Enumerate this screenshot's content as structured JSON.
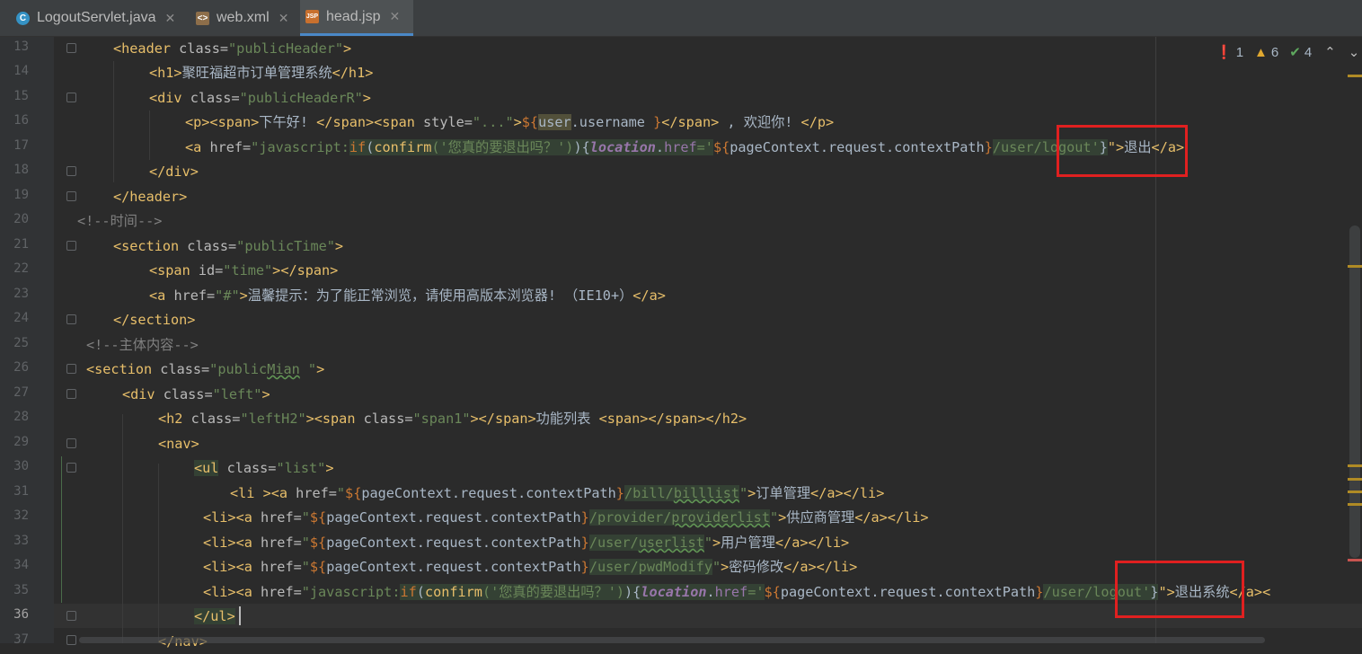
{
  "tabs": [
    {
      "label": "LogoutServlet.java",
      "icon": "java-class-icon",
      "active": false
    },
    {
      "label": "web.xml",
      "icon": "xml-file-icon",
      "active": false
    },
    {
      "label": "head.jsp",
      "icon": "jsp-file-icon",
      "active": true
    }
  ],
  "inspections": {
    "errors": "1",
    "warnings": "6",
    "weak_warnings": "4"
  },
  "current_line": "36",
  "lines": [
    {
      "n": "13"
    },
    {
      "n": "14"
    },
    {
      "n": "15"
    },
    {
      "n": "16"
    },
    {
      "n": "17"
    },
    {
      "n": "18"
    },
    {
      "n": "19"
    },
    {
      "n": "20"
    },
    {
      "n": "21"
    },
    {
      "n": "22"
    },
    {
      "n": "23"
    },
    {
      "n": "24"
    },
    {
      "n": "25"
    },
    {
      "n": "26"
    },
    {
      "n": "27"
    },
    {
      "n": "28"
    },
    {
      "n": "29"
    },
    {
      "n": "30"
    },
    {
      "n": "31"
    },
    {
      "n": "32"
    },
    {
      "n": "33"
    },
    {
      "n": "34"
    },
    {
      "n": "35"
    },
    {
      "n": "36"
    },
    {
      "n": "37"
    }
  ],
  "code": {
    "l13_tag": "<header",
    "l13_attr": " class=",
    "l13_val": "\"publicHeader\"",
    "l13_close": ">",
    "l14_open": "<h1>",
    "l14_text": "聚旺福超市订单管理系统",
    "l14_close": "</h1>",
    "l15_tag": "<div",
    "l15_attr": " class=",
    "l15_val": "\"publicHeaderR\"",
    "l15_close": ">",
    "l16_p": "<p><span>",
    "l16_text1": "下午好! ",
    "l16_mid": "</span><span",
    "l16_attr": " style=",
    "l16_val": "\"...\"",
    "l16_gt": ">",
    "l16_el1": "${",
    "l16_user": "user",
    "l16_el2": ".username ",
    "l16_el3": "}",
    "l16_end": "</span>",
    "l16_text2": " , 欢迎你! ",
    "l16_pclose": "</p>",
    "l17_tag": "<a",
    "l17_attr": " href=",
    "l17_q1": "\"javascript:",
    "l17_if": "if",
    "l17_paren": "(",
    "l17_confirm": "confirm",
    "l17_str": "('您真的要退出吗？')",
    "l17_brace": "){",
    "l17_loc": "location",
    "l17_dot": ".",
    "l17_href": "href",
    "l17_eq": "='",
    "l17_el": "${",
    "l17_ctx": "pageContext.request.contextPath",
    "l17_elc": "}",
    "l17_path": "/user/logout'",
    "l17_rb": "}",
    "l17_q2": "\">",
    "l17_text": "退出",
    "l17_close": "</a>",
    "l18": "</div>",
    "l19": "</header>",
    "l20": "<!--时间-->",
    "l21_tag": "<section",
    "l21_attr": " class=",
    "l21_val": "\"publicTime\"",
    "l21_close": ">",
    "l22_tag": "<span",
    "l22_attr": " id=",
    "l22_val": "\"time\"",
    "l22_close": "></span>",
    "l23_tag": "<a",
    "l23_attr": " href=",
    "l23_val": "\"#\"",
    "l23_gt": ">",
    "l23_text": "温馨提示：为了能正常浏览，请使用高版本浏览器! （IE10+）",
    "l23_close": "</a>",
    "l24": "</section>",
    "l25": "<!--主体内容-->",
    "l26_tag": "<section",
    "l26_attr": " class=",
    "l26_q": "\"public",
    "l26_mian": "Mian",
    "l26_q2": " \"",
    "l26_close": ">",
    "l27_tag": "<div",
    "l27_attr": " class=",
    "l27_val": "\"left\"",
    "l27_close": ">",
    "l28_tag": "<h2",
    "l28_attr": " class=",
    "l28_val": "\"leftH2\"",
    "l28_span": "><span",
    "l28_attr2": " class=",
    "l28_val2": "\"span1\"",
    "l28_close": "></span>",
    "l28_text": "功能列表 ",
    "l28_end": "<span></span></h2>",
    "l29": "<nav>",
    "l30_tag": "<ul",
    "l30_attr": " class=",
    "l30_val": "\"list\"",
    "l30_close": ">",
    "l31_tag": "<li ><a",
    "l31_attr": " href=",
    "l31_q": "\"",
    "l31_el": "${",
    "l31_ctx": "pageContext.request.contextPath",
    "l31_elc": "}",
    "l31_path": "/bill/",
    "l31_path2": "billlist",
    "l31_q2": "\"",
    "l31_gt": ">",
    "l31_text": "订单管理",
    "l31_close": "</a></li>",
    "l32_tag": "<li><a",
    "l32_attr": " href=",
    "l32_q": "\"",
    "l32_el": "${",
    "l32_ctx": "pageContext.request.contextPath",
    "l32_elc": "}",
    "l32_path": "/provider/",
    "l32_path2": "providerlist",
    "l32_q2": "\"",
    "l32_gt": ">",
    "l32_text": "供应商管理",
    "l32_close": "</a></li>",
    "l33_tag": "<li><a",
    "l33_attr": " href=",
    "l33_q": "\"",
    "l33_el": "${",
    "l33_ctx": "pageContext.request.contextPath",
    "l33_elc": "}",
    "l33_path": "/user/",
    "l33_path2": "userlist",
    "l33_q2": "\"",
    "l33_gt": ">",
    "l33_text": "用户管理",
    "l33_close": "</a></li>",
    "l34_tag": "<li><a",
    "l34_attr": " href=",
    "l34_q": "\"",
    "l34_el": "${",
    "l34_ctx": "pageContext.request.contextPath",
    "l34_elc": "}",
    "l34_path": "/user/pwdModify",
    "l34_q2": "\"",
    "l34_gt": ">",
    "l34_text": "密码修改",
    "l34_close": "</a></li>",
    "l35_tag": "<li><a",
    "l35_attr": " href=",
    "l35_q1": "\"javascript:",
    "l35_if": "if",
    "l35_paren": "(",
    "l35_confirm": "confirm",
    "l35_str": "('您真的要退出吗？')",
    "l35_brace": "){",
    "l35_loc": "location",
    "l35_dot": ".",
    "l35_href": "href",
    "l35_eq": "='",
    "l35_el": "${",
    "l35_ctx": "pageContext.request.contextPath",
    "l35_elc": "}",
    "l35_path": "/user/logout'",
    "l35_rb": "}",
    "l35_q2": "\">",
    "l35_text": "退出系统",
    "l35_close": "</a><",
    "l36_tag": "</ul",
    "l36_gt": ">",
    "l37": "</nav>"
  }
}
